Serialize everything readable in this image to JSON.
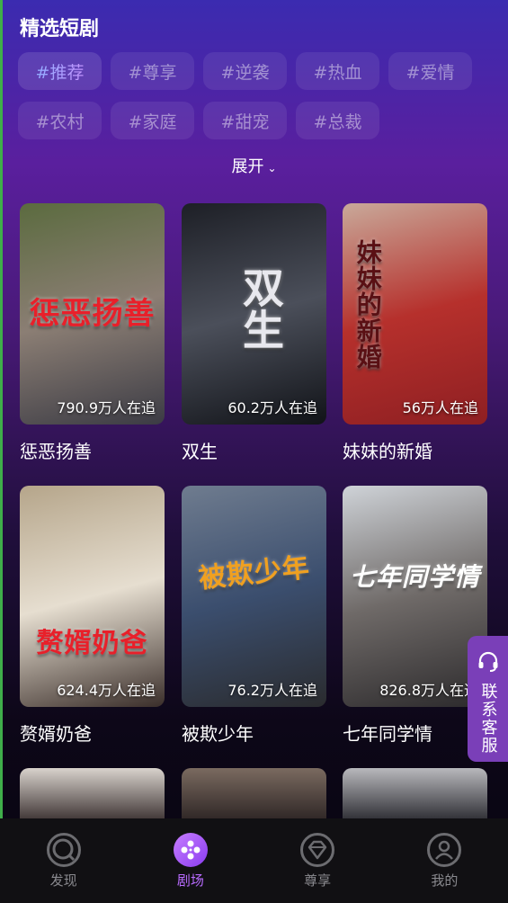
{
  "section_title": "精选短剧",
  "tags": [
    "#推荐",
    "#尊享",
    "#逆袭",
    "#热血",
    "#爱情",
    "#农村",
    "#家庭",
    "#甜宠",
    "#总裁"
  ],
  "expand_label": "展开",
  "dramas": [
    {
      "name": "惩恶扬善",
      "poster_text": "惩恶扬善",
      "watchers": "790.9万人在追",
      "colors": [
        "#5b6b3f",
        "#8b7e74",
        "#3b3b44"
      ],
      "title_color": "#e8202a"
    },
    {
      "name": "双生",
      "poster_text": "双生",
      "watchers": "60.2万人在追",
      "colors": [
        "#1d1f26",
        "#4b4f5a",
        "#111318"
      ],
      "title_color": "#e8e8ee"
    },
    {
      "name": "妹妹的新婚",
      "poster_text": "妹妹的新婚",
      "watchers": "56万人在追",
      "colors": [
        "#c9a99a",
        "#b6302c",
        "#8e1f22"
      ],
      "title_color": "#5a1014"
    },
    {
      "name": "赘婿奶爸",
      "poster_text": "赘婿奶爸",
      "watchers": "624.4万人在追",
      "colors": [
        "#b5a58a",
        "#e6ded0",
        "#3a2e2a"
      ],
      "title_color": "#e8202a"
    },
    {
      "name": "被欺少年",
      "poster_text": "被欺少年",
      "watchers": "76.2万人在追",
      "colors": [
        "#6f7c8f",
        "#3b4e6e",
        "#2a2b2e"
      ],
      "title_color": "#f0a020"
    },
    {
      "name": "七年同学情",
      "poster_text": "七年同学情",
      "watchers": "826.8万人在追",
      "colors": [
        "#cfd3d8",
        "#6f6a68",
        "#2c2a2c"
      ],
      "title_color": "#ffffff"
    }
  ],
  "customer_service": {
    "label": "联系客服"
  },
  "tabbar": [
    {
      "label": "发现",
      "active": false
    },
    {
      "label": "剧场",
      "active": true
    },
    {
      "label": "尊享",
      "active": false
    },
    {
      "label": "我的",
      "active": false
    }
  ],
  "accent_color": "#b96bff"
}
